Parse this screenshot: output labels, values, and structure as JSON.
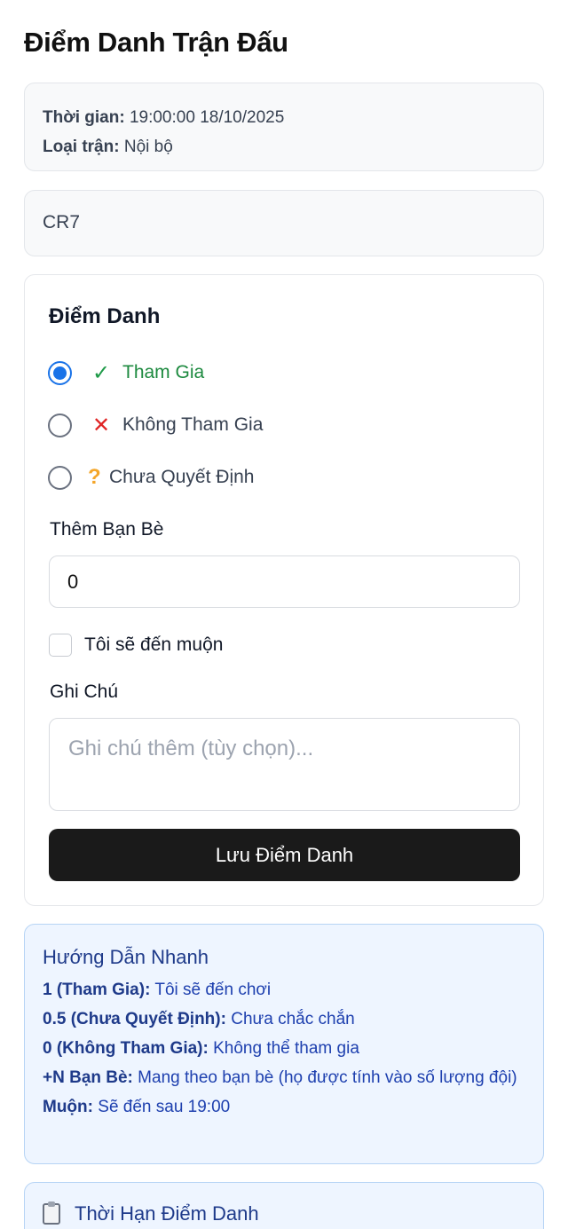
{
  "page_title": "Điểm Danh Trận Đấu",
  "match": {
    "time_label": "Thời gian:",
    "time_value": "19:00:00 18/10/2025",
    "type_label": "Loại trận:",
    "type_value": "Nội bộ"
  },
  "player": {
    "name": "CR7"
  },
  "attendance": {
    "title": "Điểm Danh",
    "options": [
      {
        "icon": "check-icon",
        "glyph": "✓",
        "label": "Tham Gia",
        "selected": true
      },
      {
        "icon": "cross-icon",
        "glyph": "✕",
        "label": "Không Tham Gia",
        "selected": false
      },
      {
        "icon": "question-icon",
        "glyph": "?",
        "label": "Chưa Quyết Định",
        "selected": false
      }
    ],
    "friends_label": "Thêm Bạn Bè",
    "friends_value": "0",
    "late_label": "Tôi sẽ đến muộn",
    "late_checked": false,
    "note_label": "Ghi Chú",
    "note_placeholder": "Ghi chú thêm (tùy chọn)...",
    "save_label": "Lưu Điểm Danh"
  },
  "guide": {
    "title": "Hướng Dẫn Nhanh",
    "lines": [
      {
        "key": "1 (Tham Gia):",
        "text": "Tôi sẽ đến chơi"
      },
      {
        "key": "0.5 (Chưa Quyết Định):",
        "text": "Chưa chắc chắn"
      },
      {
        "key": "0 (Không Tham Gia):",
        "text": "Không thể tham gia"
      },
      {
        "key": "+N Bạn Bè:",
        "text": "Mang theo bạn bè (họ được tính vào số lượng đội)"
      },
      {
        "key": "Muộn:",
        "text": "Sẽ đến sau 19:00"
      }
    ]
  },
  "deadline": {
    "icon": "clipboard-icon",
    "title": "Thời Hạn Điểm Danh"
  },
  "colors": {
    "accent": "#1a73e8",
    "success": "#1d8a3f",
    "danger": "#e02424",
    "warning": "#f4a62a",
    "primary_button": "#1a1a1a",
    "info_bg": "#eef5ff"
  }
}
